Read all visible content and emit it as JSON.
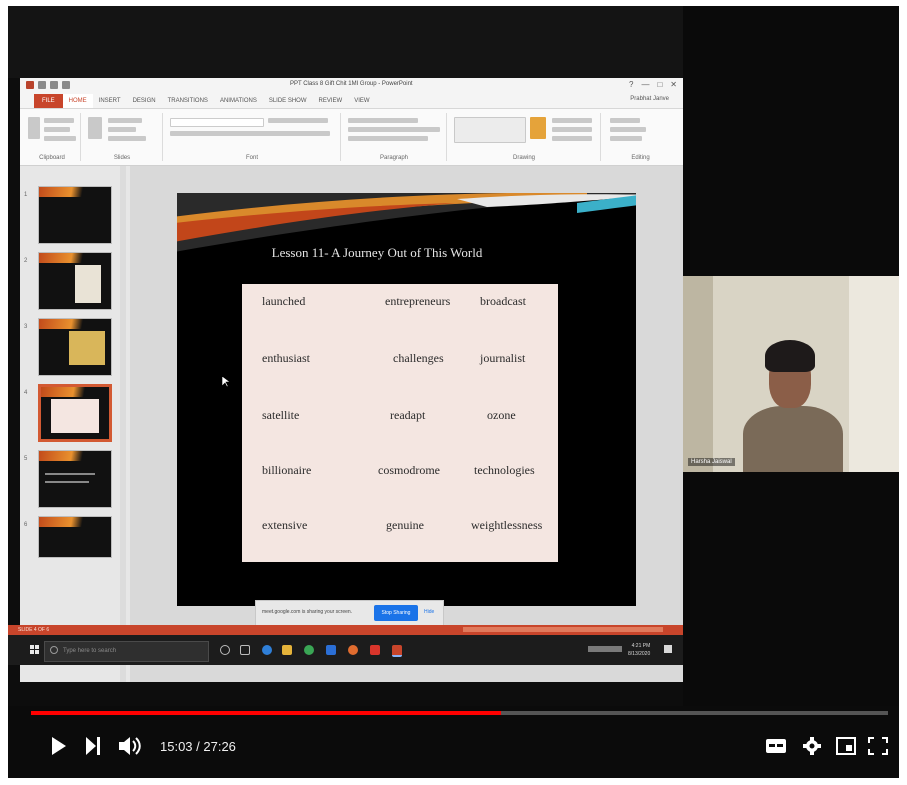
{
  "powerpoint": {
    "window_title": "PPT Class 8 Gift Chit 1MI Group - PowerPoint",
    "window_controls": [
      "?",
      "—",
      "□",
      "✕"
    ],
    "account": "Prabhat Janve",
    "tabs": [
      "FILE",
      "HOME",
      "INSERT",
      "DESIGN",
      "TRANSITIONS",
      "ANIMATIONS",
      "SLIDE SHOW",
      "REVIEW",
      "VIEW"
    ],
    "ribbon_groups": [
      "Clipboard",
      "Slides",
      "Font",
      "Paragraph",
      "Drawing",
      "Editing"
    ],
    "slide_numbers": [
      "1",
      "2",
      "3",
      "4",
      "5",
      "6"
    ],
    "slide": {
      "title": "Lesson 11- A Journey Out of This World",
      "words": [
        [
          "launched",
          "entrepreneurs",
          "broadcast"
        ],
        [
          "enthusiast",
          "challenges",
          "journalist"
        ],
        [
          "satellite",
          "readapt",
          "ozone"
        ],
        [
          "billionaire",
          "cosmodrome",
          "technologies"
        ],
        [
          "extensive",
          "genuine",
          "weightlessness"
        ]
      ]
    },
    "status": "SLIDE 4 OF 6"
  },
  "notification": {
    "text": "meet.google.com is sharing your screen.",
    "stop_label": "Stop Sharing",
    "hide_label": "Hide"
  },
  "taskbar": {
    "search_placeholder": "Type here to search",
    "clock_time": "4:21 PM",
    "clock_date": "8/13/2020"
  },
  "webcam": {
    "participant_name": "Harsha Jaiswal"
  },
  "player": {
    "current_time": "15:03",
    "duration": "27:26",
    "time_display": "15:03 / 27:26",
    "progress_fraction": 0.548,
    "accent": "#ff0000",
    "icons": [
      "play-icon",
      "next-icon",
      "volume-icon",
      "subtitles-icon",
      "settings-gear-icon",
      "miniplayer-icon",
      "fullscreen-icon"
    ]
  }
}
